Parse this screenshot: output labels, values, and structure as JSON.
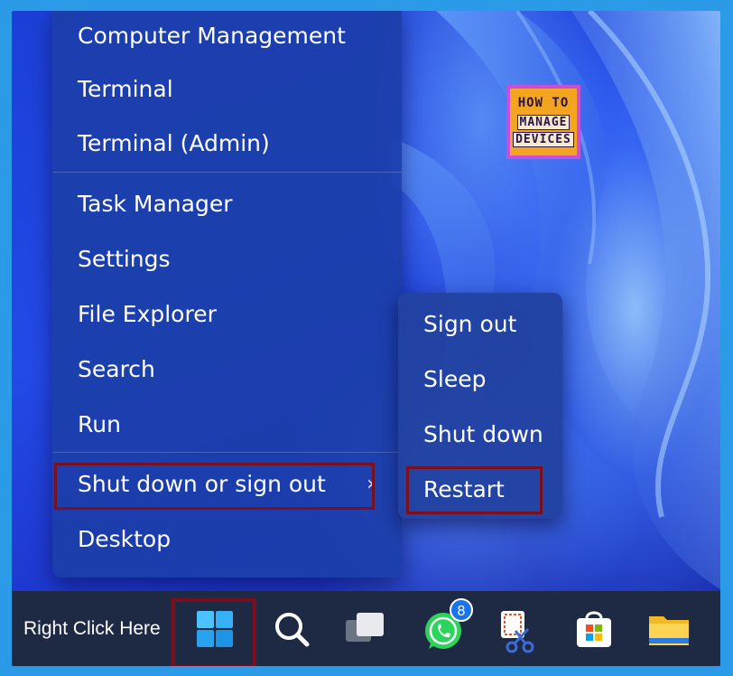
{
  "menu": {
    "items": [
      {
        "label": "Computer Management"
      },
      {
        "label": "Terminal"
      },
      {
        "label": "Terminal (Admin)"
      },
      {
        "label": "Task Manager"
      },
      {
        "label": "Settings"
      },
      {
        "label": "File Explorer"
      },
      {
        "label": "Search"
      },
      {
        "label": "Run"
      },
      {
        "label": "Shut down or sign out",
        "has_submenu": true,
        "chevron": "›"
      },
      {
        "label": "Desktop"
      }
    ]
  },
  "submenu": {
    "items": [
      {
        "label": "Sign out"
      },
      {
        "label": "Sleep"
      },
      {
        "label": "Shut down"
      },
      {
        "label": "Restart"
      }
    ]
  },
  "logo": {
    "top": "HOW TO",
    "line1": "MANAGE",
    "line2": "DEVICES"
  },
  "taskbar": {
    "label": "Right Click Here",
    "icons": [
      {
        "name": "windows-start-icon"
      },
      {
        "name": "search-icon"
      },
      {
        "name": "task-view-icon"
      },
      {
        "name": "whatsapp-icon",
        "badge": "8"
      },
      {
        "name": "snipping-tool-icon"
      },
      {
        "name": "microsoft-store-icon"
      },
      {
        "name": "file-explorer-icon"
      }
    ]
  },
  "colors": {
    "highlight": "#7a0f1f",
    "menu_bg": "#1c3eaa",
    "taskbar_bg": "#1e2944",
    "frame": "#2b9be8"
  }
}
